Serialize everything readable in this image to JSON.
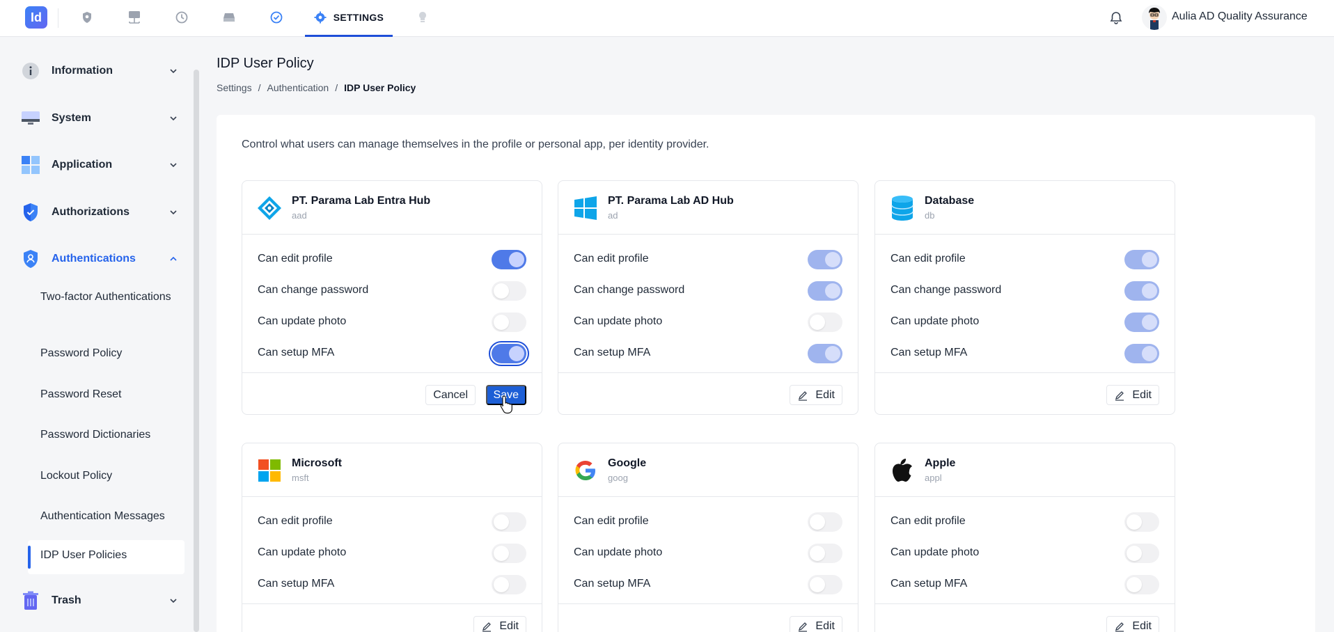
{
  "topbar": {
    "logo_text": "Id",
    "nav_icons": [
      "shield-icon",
      "monitor-tree-icon",
      "history-icon",
      "drive-icon",
      "check-circle-icon",
      "gear-icon",
      "lightbulb-icon"
    ],
    "active_tab_label": "SETTINGS",
    "user_name": "Aulia AD Quality Assurance"
  },
  "sidebar": {
    "items": [
      {
        "label": "Information",
        "icon": "info-icon"
      },
      {
        "label": "System",
        "icon": "monitor-icon"
      },
      {
        "label": "Application",
        "icon": "app-grid-icon"
      },
      {
        "label": "Authorizations",
        "icon": "shield-check-icon"
      },
      {
        "label": "Authentications",
        "icon": "shield-user-icon"
      },
      {
        "label": "Trash",
        "icon": "trash-icon"
      }
    ],
    "sub_items": [
      "Two-factor Authentications",
      "Password Policy",
      "Password Reset",
      "Password Dictionaries",
      "Lockout Policy",
      "Authentication Messages",
      "IDP User Policies"
    ]
  },
  "main": {
    "title": "IDP User Policy",
    "breadcrumb": [
      "Settings",
      "/",
      "Authentication",
      "/",
      "IDP User Policy"
    ],
    "description": "Control what users can manage themselves in the profile or personal app, per identity provider.",
    "cards": [
      {
        "name": "PT. Parama Lab Entra Hub",
        "code": "aad",
        "icon": "entra-icon",
        "rows": [
          {
            "label": "Can edit profile",
            "on": true
          },
          {
            "label": "Can change password",
            "on": false
          },
          {
            "label": "Can update photo",
            "on": false
          },
          {
            "label": "Can setup MFA",
            "on": true
          }
        ],
        "cancel_label": "Cancel",
        "save_label": "Save"
      },
      {
        "name": "PT. Parama Lab AD Hub",
        "code": "ad",
        "icon": "windows-icon",
        "rows": [
          {
            "label": "Can edit profile",
            "on": true
          },
          {
            "label": "Can change password",
            "on": true
          },
          {
            "label": "Can update photo",
            "on": false
          },
          {
            "label": "Can setup MFA",
            "on": true
          }
        ],
        "edit_label": "Edit"
      },
      {
        "name": "Database",
        "code": "db",
        "icon": "database-icon",
        "rows": [
          {
            "label": "Can edit profile",
            "on": true
          },
          {
            "label": "Can change password",
            "on": true
          },
          {
            "label": "Can update photo",
            "on": true
          },
          {
            "label": "Can setup MFA",
            "on": true
          }
        ],
        "edit_label": "Edit"
      },
      {
        "name": "Microsoft",
        "code": "msft",
        "icon": "microsoft-icon",
        "rows": [
          {
            "label": "Can edit profile",
            "on": false
          },
          {
            "label": "Can update photo",
            "on": false
          },
          {
            "label": "Can setup MFA",
            "on": false
          }
        ],
        "edit_label": "Edit"
      },
      {
        "name": "Google",
        "code": "goog",
        "icon": "google-icon",
        "rows": [
          {
            "label": "Can edit profile",
            "on": false
          },
          {
            "label": "Can update photo",
            "on": false
          },
          {
            "label": "Can setup MFA",
            "on": false
          }
        ],
        "edit_label": "Edit"
      },
      {
        "name": "Apple",
        "code": "appl",
        "icon": "apple-icon",
        "rows": [
          {
            "label": "Can edit profile",
            "on": false
          },
          {
            "label": "Can update photo",
            "on": false
          },
          {
            "label": "Can setup MFA",
            "on": false
          }
        ],
        "edit_label": "Edit"
      }
    ]
  },
  "colors": {
    "accent": "#2563eb",
    "save_button": "#1d5fd6",
    "toggle_on": "#4f7ae8",
    "toggle_on_muted": "#9fb4ee"
  }
}
